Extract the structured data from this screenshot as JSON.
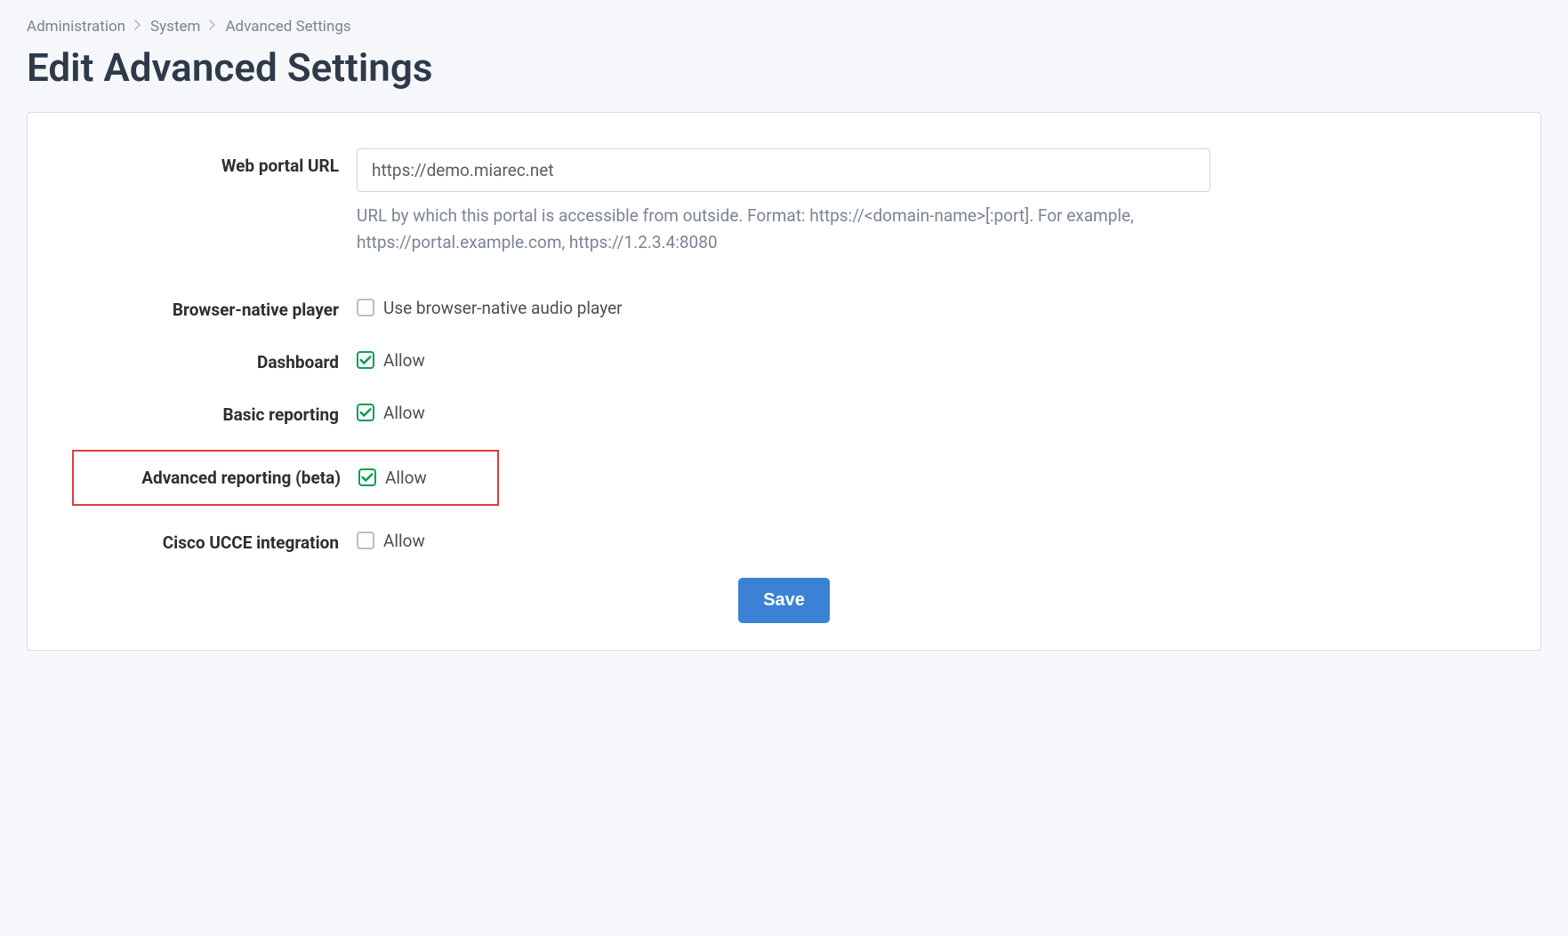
{
  "breadcrumb": {
    "items": [
      "Administration",
      "System",
      "Advanced Settings"
    ]
  },
  "page": {
    "title": "Edit Advanced Settings"
  },
  "fields": {
    "web_portal_url": {
      "label": "Web portal URL",
      "value": "https://demo.miarec.net",
      "help": "URL by which this portal is accessible from outside. Format: https://<domain-name>[:port]. For example, https://portal.example.com, https://1.2.3.4:8080"
    },
    "browser_native_player": {
      "label": "Browser-native player",
      "checkbox_label": "Use browser-native audio player",
      "checked": false
    },
    "dashboard": {
      "label": "Dashboard",
      "checkbox_label": "Allow",
      "checked": true
    },
    "basic_reporting": {
      "label": "Basic reporting",
      "checkbox_label": "Allow",
      "checked": true
    },
    "advanced_reporting": {
      "label": "Advanced reporting (beta)",
      "checkbox_label": "Allow",
      "checked": true
    },
    "cisco_ucce": {
      "label": "Cisco UCCE integration",
      "checkbox_label": "Allow",
      "checked": false
    }
  },
  "actions": {
    "save": "Save"
  }
}
